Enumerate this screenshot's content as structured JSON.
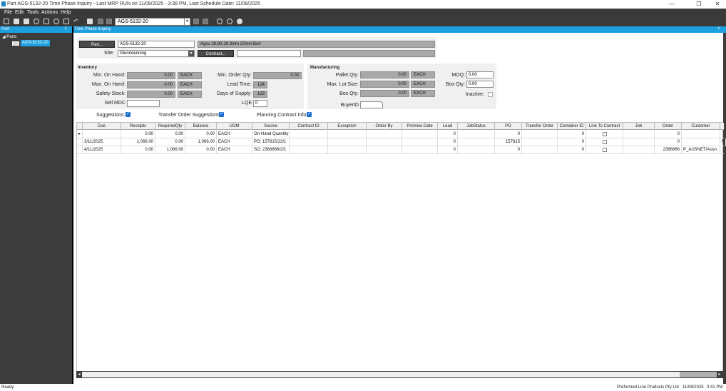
{
  "window": {
    "title": "Part AGS-5132-20 Time Phase Inquiry - Last MRP RUN on 11/08/2025 - 3:38 PM, Last Schedule Date: 11/08/2025",
    "min": "—",
    "max": "❐",
    "close": "✕"
  },
  "menu": [
    "File",
    "Edit",
    "Tools",
    "Actions",
    "Help"
  ],
  "toolbar": {
    "part_value": "AGS-5132-20"
  },
  "left_panel": {
    "header": "Part",
    "pin": "ᵖ",
    "tree_root": "Parts",
    "tree_item": "AGS-5132-20"
  },
  "right_panel": {
    "header": "Time Phase Inquiry",
    "pin": "ᵖ"
  },
  "form": {
    "part_button": "Part...",
    "part_value": "AGS-5132-20",
    "part_desc": "Agsu 28.90-29.3mm 20mm Bolt",
    "site_label": "Site:",
    "site_value": "Glenndenning",
    "contract_button": "Contract...",
    "contract_value": "",
    "contract_desc": ""
  },
  "inventory": {
    "header": "Inventory",
    "min_on_hand_label": "Min. On Hand:",
    "min_on_hand": "0.00",
    "min_on_hand_uom": "EACH",
    "max_on_hand_label": "Max. On Hand:",
    "max_on_hand": "0.00",
    "max_on_hand_uom": "EACH",
    "safety_stock_label": "Safety Stock:",
    "safety_stock": "0.00",
    "safety_stock_uom": "EACH",
    "sell_mdc_label": "Sell MDC",
    "sell_mdc": "",
    "min_order_qty_label": "Min. Order Qty:",
    "min_order_qty": "0.00",
    "lead_time_label": "Lead Time:",
    "lead_time": "124",
    "days_supply_label": "Days of Supply:",
    "days_supply": "123",
    "lqe_label": "LQE",
    "lqe": "0"
  },
  "manufacturing": {
    "header": "Manufacturing",
    "pallet_qty_label": "Pallet Qty:",
    "pallet_qty": "0.00",
    "pallet_qty_uom": "EACH",
    "max_lot_label": "Max. Lot Size:",
    "max_lot": "0.00",
    "max_lot_uom": "EACH",
    "box_qty_label": "Box Qty:",
    "box_qty": "0.00",
    "box_qty_uom": "EACH",
    "moq_label": "MOQ:",
    "moq": "0.00",
    "box_qty2_label": "Box Qty:",
    "box_qty2": "0.00",
    "inactive_label": "Inactive:",
    "buyer_label": "BuyerID",
    "buyer": ""
  },
  "options": {
    "suggestions_label": "Suggestions:",
    "transfer_label": "Transfer Order Suggestions:",
    "planning_label": "Planning Contract Info:",
    "check": "✓"
  },
  "grid": {
    "columns": [
      "",
      "Due",
      "Receipts",
      "RequiredQty",
      "Balance",
      "UOM",
      "Source",
      "Contract ID",
      "Exception",
      "Order By",
      "Promise Date",
      "Lead",
      "JobStatus",
      "PO",
      "Transfer Order",
      "Container ID",
      "Link To Contract",
      "Job",
      "Order",
      "Customer"
    ],
    "rows": [
      [
        "▸",
        "",
        "0.00",
        "0.00",
        "0.00",
        "EACH",
        "On-Hand Quantity",
        "",
        "",
        "",
        "",
        "0",
        "",
        "0",
        "",
        "0",
        "",
        "",
        "0",
        ""
      ],
      [
        "",
        "3/11/2025",
        "1,066.00",
        "0.00",
        "1,066.00",
        "EACH",
        "PO: 157815/22/1",
        "",
        "",
        "",
        "",
        "0",
        "",
        "157815",
        "",
        "0",
        "",
        "",
        "0",
        ""
      ],
      [
        "",
        "4/11/2025",
        "0.00",
        "1,066.00",
        "0.00",
        "EACH",
        "SO: 2366866/2/1",
        "",
        "",
        "",
        "",
        "0",
        "",
        "0",
        "",
        "0",
        "",
        "",
        "2366866",
        "P_AUSNET/Ausn"
      ]
    ],
    "row3_edge": "F"
  },
  "scroll": {
    "left": "◂",
    "right": "▸"
  },
  "status": {
    "left": "Ready",
    "company": "Preformed Line Products Pty Ltd",
    "date": "11/08/2025",
    "time": "3:41 PM"
  }
}
